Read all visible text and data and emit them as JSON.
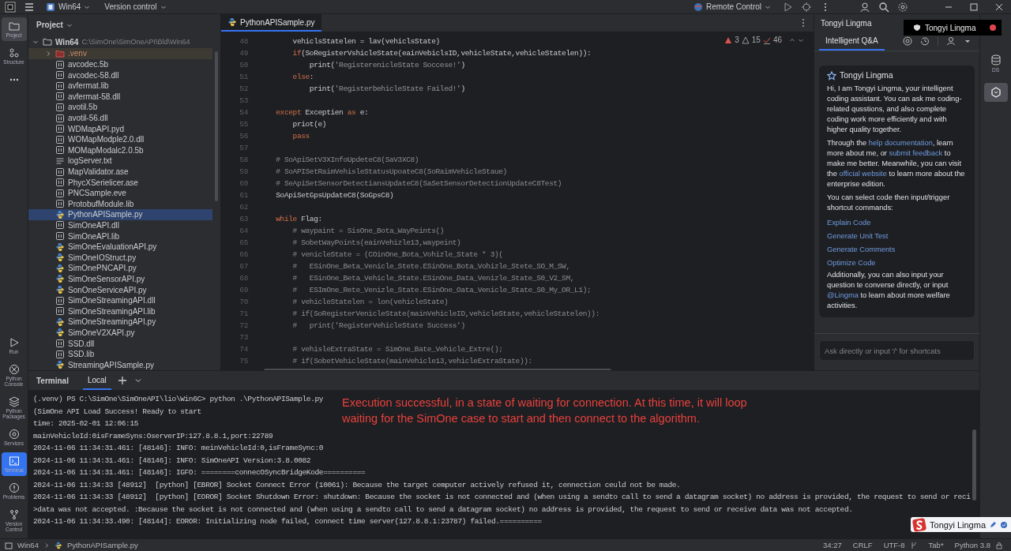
{
  "title_bar": {
    "project": "Win64",
    "vcs": "Version control",
    "run_config": "Remote Control"
  },
  "tool_strip_top": [
    {
      "label": "Project",
      "selected": true
    },
    {
      "label": "Structure",
      "selected": false
    },
    {
      "selected": false
    }
  ],
  "tool_strip_bottom": [
    {
      "label": "Run",
      "selected": false
    },
    {
      "label": "Python Console",
      "selected": false
    },
    {
      "label": "Python Packages",
      "selected": false
    },
    {
      "label": "Services",
      "selected": false
    },
    {
      "label": "Terminal",
      "selected": true
    },
    {
      "label": "Problems",
      "selected": false
    },
    {
      "label": "Version Control",
      "selected": false
    }
  ],
  "project_panel": {
    "title": "Project",
    "root": {
      "name": "Win64",
      "path": "C:\\SimOne\\SimOneAPI\\Bld\\Win64",
      "expanded": true,
      "children": [
        {
          "name": ".venv",
          "kind": "excluded",
          "expanded": false,
          "selected": false
        },
        {
          "name": "avcodec.5b",
          "kind": "lib",
          "selected": false
        },
        {
          "name": "avcodec-58.dll",
          "kind": "lib",
          "selected": false
        },
        {
          "name": "avfermat.lib",
          "kind": "lib",
          "selected": false
        },
        {
          "name": "avfermat-58.dll",
          "kind": "lib",
          "selected": false
        },
        {
          "name": "avotil.5b",
          "kind": "lib",
          "selected": false
        },
        {
          "name": "avotil-56.dll",
          "kind": "lib",
          "selected": false
        },
        {
          "name": "WDMapAPI.pyd",
          "kind": "lib",
          "selected": false
        },
        {
          "name": "WOMapModple2.0.dll",
          "kind": "lib",
          "selected": false
        },
        {
          "name": "MOMapModalc2.0.5b",
          "kind": "lib",
          "selected": false
        },
        {
          "name": "logServer.txt",
          "kind": "text",
          "selected": false
        },
        {
          "name": "MapValidator.ase",
          "kind": "lib",
          "selected": false
        },
        {
          "name": "PhycXSerielicer.ase",
          "kind": "lib",
          "selected": false
        },
        {
          "name": "PNCSample.eve",
          "kind": "lib",
          "selected": false
        },
        {
          "name": "ProtobufModule.lib",
          "kind": "lib",
          "selected": false
        },
        {
          "name": "PythonAPISample.py",
          "kind": "py",
          "selected": true
        },
        {
          "name": "SimOneAPI.dll",
          "kind": "lib",
          "selected": false
        },
        {
          "name": "SimOneAPI.lib",
          "kind": "lib",
          "selected": false
        },
        {
          "name": "SimOneEvaluationAPI.py",
          "kind": "py",
          "selected": false
        },
        {
          "name": "SimOneIOStruct.py",
          "kind": "py",
          "selected": false
        },
        {
          "name": "SimOnePNCAPI.py",
          "kind": "py",
          "selected": false
        },
        {
          "name": "SimOneSensorAPI.py",
          "kind": "py",
          "selected": false
        },
        {
          "name": "SonOneServiceAPI.py",
          "kind": "py",
          "selected": false
        },
        {
          "name": "SimOneStreamingAPI.dll",
          "kind": "lib",
          "selected": false
        },
        {
          "name": "SimOneStreamingAPI.lib",
          "kind": "lib",
          "selected": false
        },
        {
          "name": "SimOneStreamingAPI.py",
          "kind": "py",
          "selected": false
        },
        {
          "name": "SimOneV2XAPI.py",
          "kind": "py",
          "selected": false
        },
        {
          "name": "SSD.dll",
          "kind": "lib",
          "selected": false
        },
        {
          "name": "SSD.lib",
          "kind": "lib",
          "selected": false
        },
        {
          "name": "StreamingAPISample.py",
          "kind": "py",
          "selected": false
        }
      ]
    }
  },
  "editor": {
    "tabs": [
      {
        "label": "PythonAPISample.py",
        "selected": true
      }
    ],
    "inspections": {
      "errors": "3",
      "warnings": "15",
      "weak": "46"
    },
    "lines": [
      {
        "number": "48",
        "parts": [
          {
            "kind": "plain",
            "text": "        vehiclsStatelen = lav(vehiclsState)"
          }
        ]
      },
      {
        "number": "49",
        "parts": [
          {
            "kind": "kw",
            "text": "        if"
          },
          {
            "kind": "plain",
            "text": "(SoRegisterVshicleState(eainVebiclsID,vehicleState,vehicleStatelen)):"
          }
        ]
      },
      {
        "number": "50",
        "parts": [
          {
            "kind": "plain",
            "text": "            print("
          },
          {
            "kind": "str",
            "text": "'RegisterenicleState Soccese!'"
          },
          {
            "kind": "plain",
            "text": ")"
          }
        ]
      },
      {
        "number": "51",
        "parts": [
          {
            "kind": "kw",
            "text": "        else"
          },
          {
            "kind": "plain",
            "text": ":"
          }
        ]
      },
      {
        "number": "52",
        "parts": [
          {
            "kind": "plain",
            "text": "            print("
          },
          {
            "kind": "str",
            "text": "'RegisterbehicleState Failed!'"
          },
          {
            "kind": "plain",
            "text": ")"
          }
        ]
      },
      {
        "number": "53"
      },
      {
        "number": "54",
        "parts": [
          {
            "kind": "kw",
            "text": "    except"
          },
          {
            "kind": "plain",
            "text": " Exceptien "
          },
          {
            "kind": "kw",
            "text": "as"
          },
          {
            "kind": "plain",
            "text": " e:"
          }
        ]
      },
      {
        "number": "55",
        "parts": [
          {
            "kind": "plain",
            "text": "        priot(e)"
          }
        ]
      },
      {
        "number": "56",
        "parts": [
          {
            "kind": "kw",
            "text": "        pass"
          }
        ]
      },
      {
        "number": "57"
      },
      {
        "number": "58",
        "parts": [
          {
            "kind": "comment",
            "text": "    # SoApiSetV3XInfoUpdeteC8(SaV3XC8)"
          }
        ]
      },
      {
        "number": "59",
        "parts": [
          {
            "kind": "comment",
            "text": "    # SoAPISetRaimVehisleStatusUpoateC8(SoRaimVehicleStaue)"
          }
        ]
      },
      {
        "number": "60",
        "parts": [
          {
            "kind": "comment",
            "text": "    # SeApiSetSensorDetectiansUpdateC8(SaSetSensorDetectionUpdateC8Test)"
          }
        ]
      },
      {
        "number": "61",
        "parts": [
          {
            "kind": "plain",
            "text": "    SoApiSetGpsUpdateC8(SoGpsC8)"
          }
        ]
      },
      {
        "number": "62"
      },
      {
        "number": "63",
        "parts": [
          {
            "kind": "kw",
            "text": "    while"
          },
          {
            "kind": "plain",
            "text": " Flag:"
          }
        ]
      },
      {
        "number": "64",
        "parts": [
          {
            "kind": "comment",
            "text": "        # waypaint = SisOne_Bota_WayPeints()"
          }
        ]
      },
      {
        "number": "65",
        "parts": [
          {
            "kind": "comment",
            "text": "        # SobetWayPoints(eainVehizle13,waypeint)"
          }
        ]
      },
      {
        "number": "66",
        "parts": [
          {
            "kind": "comment",
            "text": "        # venicleState = (COinOne_Bota_Vohizle_State * 3)("
          }
        ]
      },
      {
        "number": "67",
        "parts": [
          {
            "kind": "comment",
            "text": "        #   ESinOne_Beta_Venicle_Stete.ESinOne_Bota_Vohizle_Stete_SO_M_SW,"
          }
        ]
      },
      {
        "number": "68",
        "parts": [
          {
            "kind": "comment",
            "text": "        #   ESinOne_Beta_Vehicle_State.ESinOne_Data_Venizle_State_S0_V2_SM,"
          }
        ]
      },
      {
        "number": "69",
        "parts": [
          {
            "kind": "comment",
            "text": "        #   ESImOne_Rete_Venizle_State.ESinOne_Oata_Venicle_State_S0_My_OR_L1);"
          }
        ]
      },
      {
        "number": "70",
        "parts": [
          {
            "kind": "comment",
            "text": "        # vehicleStatelen = lon(vehicleState)"
          }
        ]
      },
      {
        "number": "71",
        "parts": [
          {
            "kind": "comment",
            "text": "        # if(SoRegisterVenicleState(mainVehicleID,vehicleState,vehicleStatelen)):"
          }
        ]
      },
      {
        "number": "72",
        "parts": [
          {
            "kind": "comment",
            "text": "        #   print('RegisterVehicleState Success')"
          }
        ]
      },
      {
        "number": "73"
      },
      {
        "number": "74",
        "parts": [
          {
            "kind": "comment",
            "text": "        # vehisleExtraState = SimOne_Bate_Vehicle_Extre();"
          }
        ]
      },
      {
        "number": "75",
        "parts": [
          {
            "kind": "comment",
            "text": "        # if(SobetVehicleState(mainVehicle13,vehicleExtraState)):"
          }
        ]
      }
    ]
  },
  "assistant": {
    "title": "Tongyi Lingma",
    "tooltip": "Tongyi Lingma",
    "tabs": [
      {
        "label": "Intelligent Q&A",
        "selected": true
      }
    ],
    "card_title": "Tongyi Lingma",
    "paragraphs": [
      [
        {
          "kind": "text",
          "text": "Hi, I am Tongyi Lingma, your intelligent coding assistant. You can ask me coding-related qusstions, and also complete coding work more efficiently and with higher quality together."
        }
      ],
      [
        {
          "kind": "text",
          "text": "Through the "
        },
        {
          "kind": "link",
          "text": "help documentation"
        },
        {
          "kind": "text",
          "text": ", learn more about me, or "
        },
        {
          "kind": "link",
          "text": "submit feedback"
        },
        {
          "kind": "text",
          "text": " to make me better. Meanwhile, you can visit the "
        },
        {
          "kind": "link",
          "text": "official website"
        },
        {
          "kind": "text",
          "text": " to learn more about the enterprise edition."
        }
      ],
      [
        {
          "kind": "text",
          "text": "You can select code then input/trigger shortcut commands:"
        }
      ]
    ],
    "shortcuts": [
      "Explain Code",
      "Generate Unit Test",
      "Generate Comments",
      "Optimize Code"
    ],
    "closing": [
      {
        "kind": "text",
        "text": "Additionally, you can also input your question te converse directly, or input "
      },
      {
        "kind": "link",
        "text": "@Lingma"
      },
      {
        "kind": "text",
        "text": " to learn about more welfare activities."
      }
    ],
    "input": {
      "placeholder": "Ask directly or input '/' for shortcats"
    }
  },
  "right_strip": [
    {
      "label": "DS",
      "selected": false
    },
    {
      "selected": true
    }
  ],
  "terminal": {
    "title": "Terminal",
    "tabs": [
      {
        "label": "Local",
        "selected": true
      }
    ],
    "lines": [
      "(.venv) PS C:\\SimOne\\SimOneAPI\\lio\\Win6C> python .\\PythonAPISample.py",
      "(SimOne API Load Success! Ready to start",
      "time: 2025-02-01 12:06:15",
      "mainVehicleId:0isFrameSyns:OserverIP:127.8.8.1,port:22789",
      "2024-11-06 11:34:31.461: [48146]: INFO: meinVehicleId:0,isFrameSync:0",
      "2024-11-06 11:34:31.461: [48146]: INFO: SimOneAPI Version:3.8.0082",
      "2024-11-06 11:34:31.461: [48146]: IGFO: ========connecOSyncBridgeKode==========",
      "2024-11-06 11:34:33 [48912]  [python] [EBROR] Socket Connect Error (10061): Because the target cemputer actively refused it, cennection ceuld not be made.",
      "2024-11-06 11:34:33 [48912]  [python] [EOROR] Socket Shutdown Error: shutdown: Because the socket is not connected and (when using a sendto call to send a datagram socket) no address is provided, the request to send or reci",
      ">data was not accepted. :Because the socket is not connected and (when using a sendto call to send a datagram socket) no address is provided, the request to send or receive data was not accepted.",
      "2024-11-06 11:34:33.490: [48144]: EOROR: Initializing node failed, connect time server(127.8.8.1:23787) failed.=========="
    ],
    "annotation": "Execution successful, in a state of waiting for connection. At this time, it will loop waiting for the SimOne case to start and then connect to the algorithm."
  },
  "ime_badge": {
    "label": "Tongyi Lingma"
  },
  "status_bar": {
    "breadcrumbs": [
      "Win64",
      "PythonAPISample.py"
    ],
    "items": [
      "34:27",
      "CRLF",
      "UTF-8",
      "Tab*",
      "Python 3.8"
    ]
  }
}
